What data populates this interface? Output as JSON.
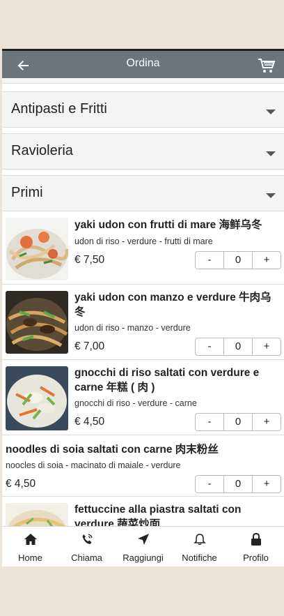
{
  "header": {
    "title": "Ordina",
    "back_icon": "arrow-left-icon",
    "cart_icon": "cart-icon"
  },
  "categories": [
    {
      "label": "Antipasti e Fritti"
    },
    {
      "label": "Ravioleria"
    },
    {
      "label": "Primi"
    }
  ],
  "items": [
    {
      "name": "yaki udon con frutti di mare 海鲜乌冬",
      "desc": "udon di riso - verdure - frutti di mare",
      "price": "€ 7,50",
      "qty": "0",
      "minus": "-",
      "plus": "+"
    },
    {
      "name": "yaki udon con manzo e verdure 牛肉乌冬",
      "desc": "udon di riso - manzo - verdure",
      "price": "€ 7,00",
      "qty": "0",
      "minus": "-",
      "plus": "+"
    },
    {
      "name": "gnocchi di riso saltati con verdure e carne 年糕 ( 肉 )",
      "desc": "gnocchi di riso - verdure - carne",
      "price": "€ 4,50",
      "qty": "0",
      "minus": "-",
      "plus": "+"
    },
    {
      "name": "noodles di soia saltati con carne 肉末粉丝",
      "desc": "noocles di soia - macinato di maiale - verdure",
      "price": "€ 4,50",
      "qty": "0",
      "minus": "-",
      "plus": "+"
    },
    {
      "name": "fettuccine alla piastra saltati con verdure 蔬菜炒面"
    }
  ],
  "tabbar": [
    {
      "label": "Home",
      "icon": "home-icon"
    },
    {
      "label": "Chiama",
      "icon": "phone-icon"
    },
    {
      "label": "Raggiungi",
      "icon": "location-arrow-icon"
    },
    {
      "label": "Notifiche",
      "icon": "bell-icon"
    },
    {
      "label": "Profilo",
      "icon": "lock-icon"
    }
  ],
  "colors": {
    "header_bg": "#6d757c",
    "page_bg": "#ece4d8",
    "category_bg": "#f4f4f4"
  }
}
